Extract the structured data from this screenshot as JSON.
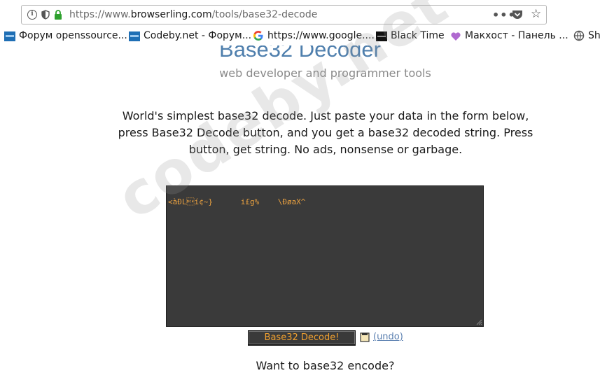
{
  "browser": {
    "url_prefix": "https://www.",
    "url_domain": "browserling.com",
    "url_path": "/tools/base32-decode",
    "more_glyph": "•••",
    "star_glyph": "☆"
  },
  "bookmarks": [
    {
      "label": "Форум openssource...",
      "icon": "codeby-favicon"
    },
    {
      "label": "Codeby.net - Форум...",
      "icon": "codeby-favicon"
    },
    {
      "label": "https://www.google....",
      "icon": "google-g-icon"
    },
    {
      "label": "Black Time",
      "icon": "blacktime-favicon"
    },
    {
      "label": "Макхост - Панель ...",
      "icon": "heart-favicon"
    },
    {
      "label": "Sh",
      "icon": "globe-icon"
    }
  ],
  "page": {
    "title": "Base32 Decoder",
    "subtitle": "web developer and programmer tools",
    "description": "World's simplest base32 decode. Just paste your data in the form below, press Base32 Decode button, and you get a base32 decoded string. Press button, get string. No ads, nonsense or garbage.",
    "editor_content": "<àÐL\u0014í¢~}      i£g%    \\ÐøaX^",
    "decode_button": "Base32 Decode!",
    "undo_link": "(undo)",
    "encode_heading": "Want to base32 encode?"
  },
  "watermark": "codeby.net",
  "colors": {
    "title": "#4f7fad",
    "button_text": "#f0a030",
    "editor_bg": "#3a3a3a",
    "editor_text": "#e8a040",
    "link": "#5a7fb0"
  }
}
